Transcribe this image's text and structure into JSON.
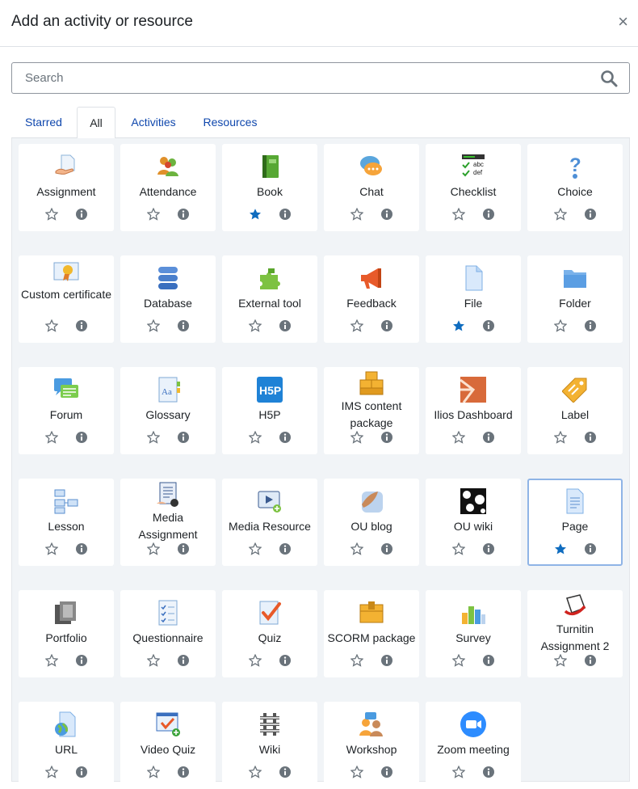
{
  "dialog": {
    "title": "Add an activity or resource",
    "close": "×"
  },
  "search": {
    "placeholder": "Search"
  },
  "tabs": [
    {
      "label": "Starred"
    },
    {
      "label": "All",
      "active": true
    },
    {
      "label": "Activities"
    },
    {
      "label": "Resources"
    }
  ],
  "colors": {
    "star_filled": "#0f6cbf",
    "star_empty": "#6a737b",
    "info": "#6a737b",
    "link": "#0f47ad",
    "selected_border": "#8fb4e6"
  },
  "items": [
    {
      "label": "Assignment",
      "icon": "assignment-icon",
      "starred": false
    },
    {
      "label": "Attendance",
      "icon": "attendance-icon",
      "starred": false
    },
    {
      "label": "Book",
      "icon": "book-icon",
      "starred": true
    },
    {
      "label": "Chat",
      "icon": "chat-icon",
      "starred": false
    },
    {
      "label": "Checklist",
      "icon": "checklist-icon",
      "starred": false
    },
    {
      "label": "Choice",
      "icon": "choice-icon",
      "starred": false
    },
    {
      "label": "Custom certificate",
      "icon": "certificate-icon",
      "starred": false
    },
    {
      "label": "Database",
      "icon": "database-icon",
      "starred": false
    },
    {
      "label": "External tool",
      "icon": "puzzle-icon",
      "starred": false
    },
    {
      "label": "Feedback",
      "icon": "megaphone-icon",
      "starred": false
    },
    {
      "label": "File",
      "icon": "file-icon",
      "starred": true
    },
    {
      "label": "Folder",
      "icon": "folder-icon",
      "starred": false
    },
    {
      "label": "Forum",
      "icon": "forum-icon",
      "starred": false
    },
    {
      "label": "Glossary",
      "icon": "glossary-icon",
      "starred": false
    },
    {
      "label": "H5P",
      "icon": "h5p-icon",
      "starred": false
    },
    {
      "label": "IMS content package",
      "icon": "ims-package-icon",
      "starred": false
    },
    {
      "label": "Ilios Dashboard",
      "icon": "ilios-icon",
      "starred": false
    },
    {
      "label": "Label",
      "icon": "label-icon",
      "starred": false
    },
    {
      "label": "Lesson",
      "icon": "lesson-icon",
      "starred": false
    },
    {
      "label": "Media Assignment",
      "icon": "media-assignment-icon",
      "starred": false
    },
    {
      "label": "Media Resource",
      "icon": "media-resource-icon",
      "starred": false
    },
    {
      "label": "OU blog",
      "icon": "ou-blog-icon",
      "starred": false
    },
    {
      "label": "OU wiki",
      "icon": "ou-wiki-icon",
      "starred": false
    },
    {
      "label": "Page",
      "icon": "page-icon",
      "starred": true,
      "selected": true
    },
    {
      "label": "Portfolio",
      "icon": "portfolio-icon",
      "starred": false
    },
    {
      "label": "Questionnaire",
      "icon": "questionnaire-icon",
      "starred": false
    },
    {
      "label": "Quiz",
      "icon": "quiz-icon",
      "starred": false
    },
    {
      "label": "SCORM package",
      "icon": "scorm-icon",
      "starred": false
    },
    {
      "label": "Survey",
      "icon": "survey-icon",
      "starred": false
    },
    {
      "label": "Turnitin Assignment 2",
      "icon": "turnitin-icon",
      "starred": false
    },
    {
      "label": "URL",
      "icon": "url-icon",
      "starred": false
    },
    {
      "label": "Video Quiz",
      "icon": "video-quiz-icon",
      "starred": false
    },
    {
      "label": "Wiki",
      "icon": "wiki-icon",
      "starred": false
    },
    {
      "label": "Workshop",
      "icon": "workshop-icon",
      "starred": false
    },
    {
      "label": "Zoom meeting",
      "icon": "zoom-icon",
      "starred": false
    }
  ]
}
